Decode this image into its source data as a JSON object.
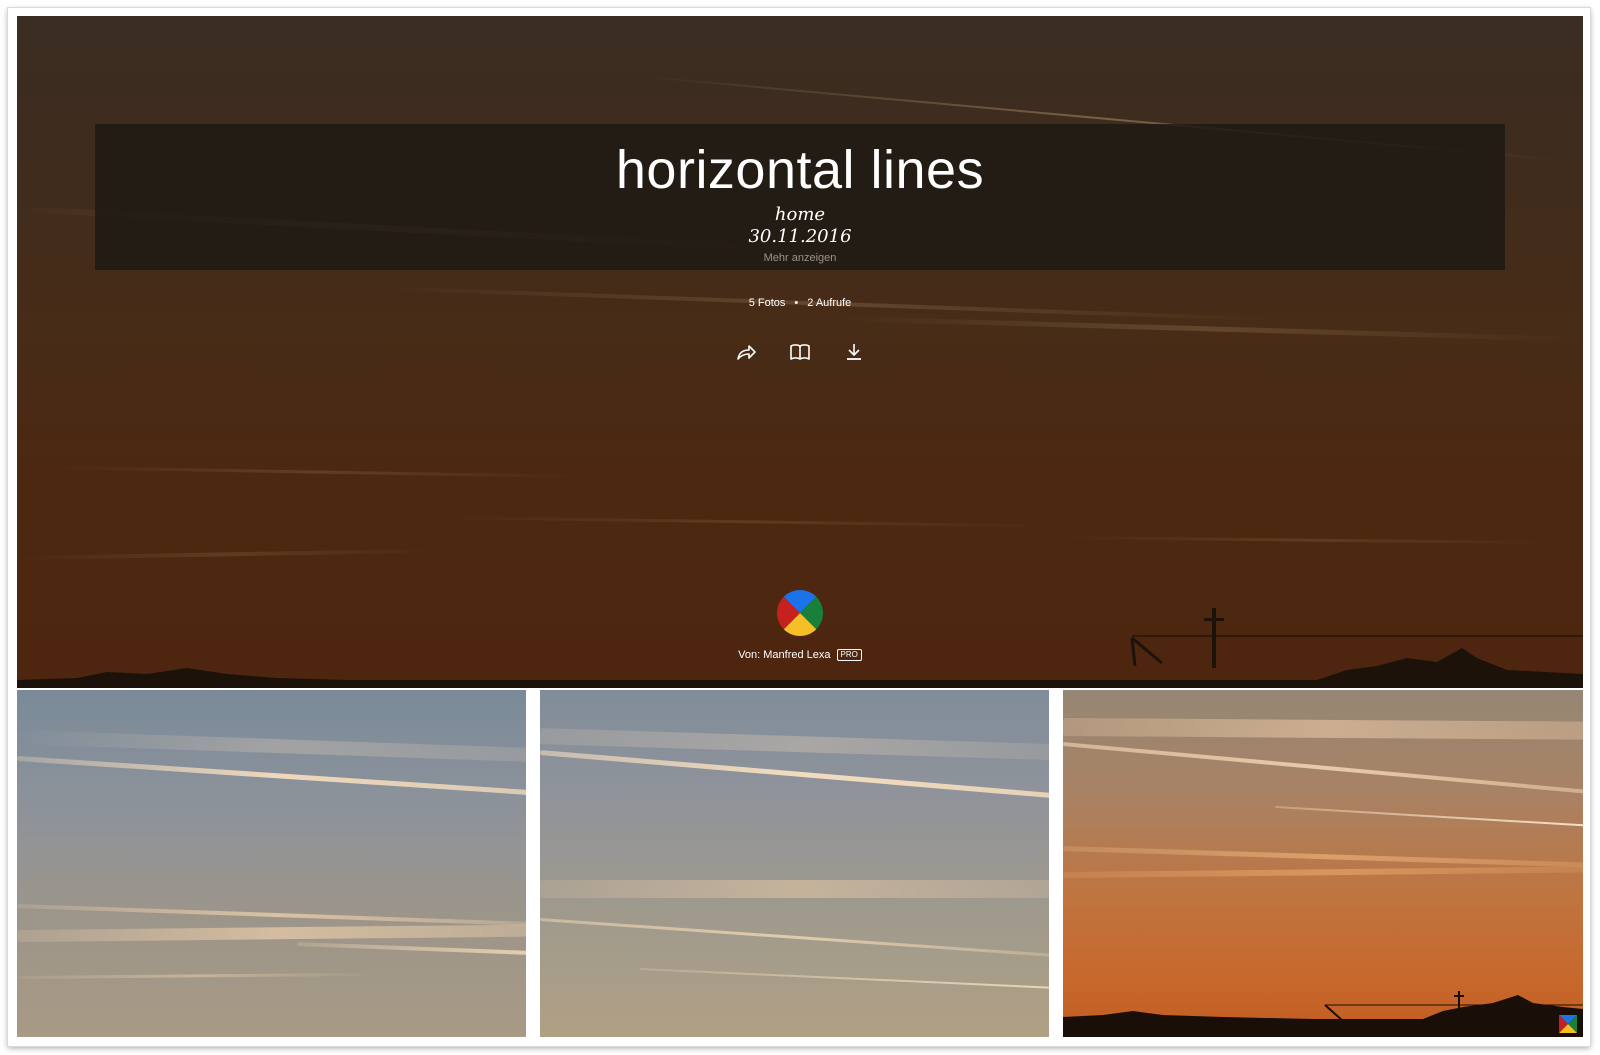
{
  "album": {
    "title": "horizontal lines",
    "description_line1": "home",
    "description_line2": "30.11.2016",
    "more_label": "Mehr anzeigen",
    "photo_count": "5 Fotos",
    "separator": "•",
    "view_count": "2 Aufrufe"
  },
  "actions": [
    {
      "icon": "share-icon"
    },
    {
      "icon": "book-icon"
    },
    {
      "icon": "download-icon"
    }
  ],
  "author": {
    "byline": "Von: Manfred Lexa",
    "badge": "PRO",
    "avatar_colors": [
      "#1a73e8",
      "#188038",
      "#f6bf26",
      "#c5221f"
    ]
  },
  "thumbnails": [
    {
      "name": "thumbnail-photo-1"
    },
    {
      "name": "thumbnail-photo-2"
    },
    {
      "name": "thumbnail-photo-3"
    }
  ]
}
